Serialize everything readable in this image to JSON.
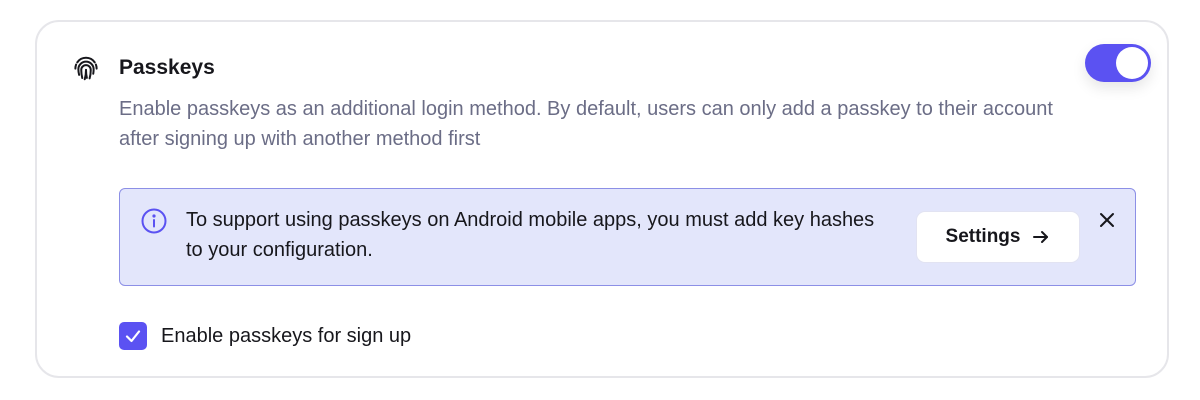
{
  "section": {
    "icon": "fingerprint-icon",
    "title": "Passkeys",
    "enabled": true,
    "description": "Enable passkeys as an additional login method. By default, users can only add a passkey to their account after signing up with another method first"
  },
  "alert": {
    "icon": "info-icon",
    "message": "To support using passkeys on Android mobile apps, you must add key hashes to your configuration.",
    "button_label": "Settings",
    "button_icon": "arrow-right-icon",
    "close_icon": "close-icon"
  },
  "signup_option": {
    "label": "Enable passkeys for sign up",
    "checked": true
  },
  "colors": {
    "accent": "#5b52f2",
    "alert_background": "#e3e6fb",
    "alert_border": "#8c8fe6",
    "description_text": "#6b6d86"
  }
}
